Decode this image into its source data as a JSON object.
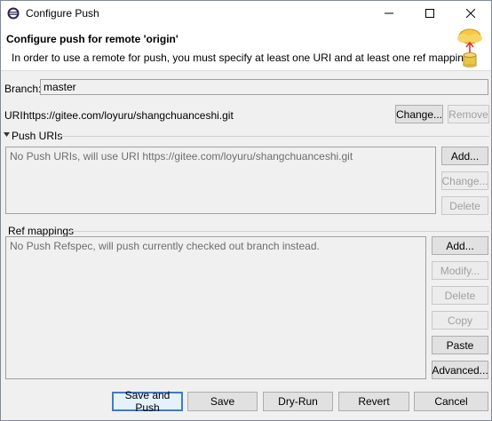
{
  "window": {
    "title": "Configure Push",
    "icons": {
      "app": "eclipse-icon",
      "minimize": "minimize-icon",
      "maximize": "maximize-icon",
      "close": "close-icon"
    }
  },
  "banner": {
    "title": "Configure push for remote 'origin'",
    "description": "In order to use a remote for push, you must specify at least one URI and at least one ref mapping",
    "icon": "cloud-push-database-icon"
  },
  "branch": {
    "label": "Branch:",
    "value": "master"
  },
  "uri": {
    "label": "URI:",
    "value": "https://gitee.com/loyuru/shangchuanceshi.git",
    "change_label": "Change...",
    "remove_label": "Remove"
  },
  "push_uris": {
    "section_label": "Push URIs",
    "expand_icon": "triangle-down-icon",
    "empty_message": "No Push URIs, will use URI https://gitee.com/loyuru/shangchuanceshi.git",
    "add_label": "Add...",
    "change_label": "Change...",
    "delete_label": "Delete"
  },
  "ref_mappings": {
    "section_label": "Ref mappings",
    "empty_message": "No Push Refspec, will push currently checked out branch instead.",
    "add_label": "Add...",
    "modify_label": "Modify...",
    "delete_label": "Delete",
    "copy_label": "Copy",
    "paste_label": "Paste",
    "advanced_label": "Advanced..."
  },
  "footer": {
    "save_and_push": "Save and Push",
    "save": "Save",
    "dry_run": "Dry-Run",
    "revert": "Revert",
    "cancel": "Cancel"
  }
}
